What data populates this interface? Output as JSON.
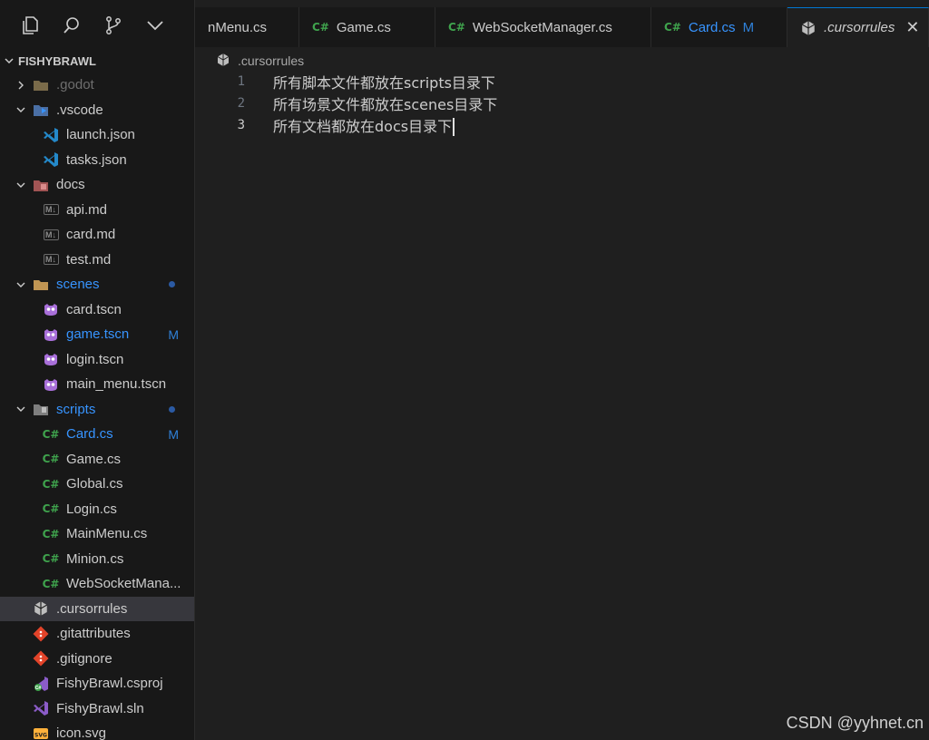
{
  "activity_bar": {
    "icons": [
      "files-icon",
      "search-icon",
      "source-control-icon",
      "chevron-down-icon"
    ]
  },
  "explorer": {
    "root_label": "FISHYBRAWL",
    "items": [
      {
        "label": ".godot",
        "kind": "folder",
        "level": 0,
        "expanded": false,
        "dim": true
      },
      {
        "label": ".vscode",
        "kind": "folder",
        "level": 0,
        "expanded": true
      },
      {
        "label": "launch.json",
        "kind": "vscode",
        "level": 1
      },
      {
        "label": "tasks.json",
        "kind": "vscode",
        "level": 1
      },
      {
        "label": "docs",
        "kind": "folder",
        "level": 0,
        "expanded": true
      },
      {
        "label": "api.md",
        "kind": "md",
        "level": 1
      },
      {
        "label": "card.md",
        "kind": "md",
        "level": 1
      },
      {
        "label": "test.md",
        "kind": "md",
        "level": 1
      },
      {
        "label": "scenes",
        "kind": "folder",
        "level": 0,
        "expanded": true,
        "modified": true
      },
      {
        "label": "card.tscn",
        "kind": "godot",
        "level": 1
      },
      {
        "label": "game.tscn",
        "kind": "godot",
        "level": 1,
        "badge": "M"
      },
      {
        "label": "login.tscn",
        "kind": "godot",
        "level": 1
      },
      {
        "label": "main_menu.tscn",
        "kind": "godot",
        "level": 1
      },
      {
        "label": "scripts",
        "kind": "folder",
        "level": 0,
        "expanded": true,
        "modified": true
      },
      {
        "label": "Card.cs",
        "kind": "cs",
        "level": 1,
        "badge": "M"
      },
      {
        "label": "Game.cs",
        "kind": "cs",
        "level": 1
      },
      {
        "label": "Global.cs",
        "kind": "cs",
        "level": 1
      },
      {
        "label": "Login.cs",
        "kind": "cs",
        "level": 1
      },
      {
        "label": "MainMenu.cs",
        "kind": "cs",
        "level": 1
      },
      {
        "label": "Minion.cs",
        "kind": "cs",
        "level": 1
      },
      {
        "label": "WebSocketMana...",
        "kind": "cs",
        "level": 1
      },
      {
        "label": ".cursorrules",
        "kind": "cursor",
        "level": 0,
        "active": true
      },
      {
        "label": ".gitattributes",
        "kind": "git",
        "level": 0
      },
      {
        "label": ".gitignore",
        "kind": "git",
        "level": 0
      },
      {
        "label": "FishyBrawl.csproj",
        "kind": "csproj",
        "level": 0
      },
      {
        "label": "FishyBrawl.sln",
        "kind": "sln",
        "level": 0
      },
      {
        "label": "icon.svg",
        "kind": "svg",
        "level": 0
      }
    ],
    "cs_glyph": "C#",
    "md_glyph": "M↓"
  },
  "tabs": [
    {
      "label": "nMenu.cs",
      "cs": false
    },
    {
      "label": "Game.cs",
      "cs": true
    },
    {
      "label": "WebSocketManager.cs",
      "cs": true
    },
    {
      "label": "Card.cs",
      "cs": true,
      "modified": "M"
    },
    {
      "label": ".cursorrules",
      "active": true,
      "close": "✕"
    }
  ],
  "breadcrumb": {
    "file": ".cursorrules"
  },
  "editor": {
    "lines": [
      {
        "num": "1",
        "text": "所有脚本文件都放在scripts目录下"
      },
      {
        "num": "2",
        "text": "所有场景文件都放在scenes目录下"
      },
      {
        "num": "3",
        "text": "所有文档都放在docs目录下",
        "current": true
      }
    ]
  },
  "watermark": "CSDN @yyhnet.cn",
  "colors": {
    "accent": "#0078d4",
    "modified": "#2f81d9",
    "csharp": "#3fa34d",
    "active_row": "#37373d"
  }
}
